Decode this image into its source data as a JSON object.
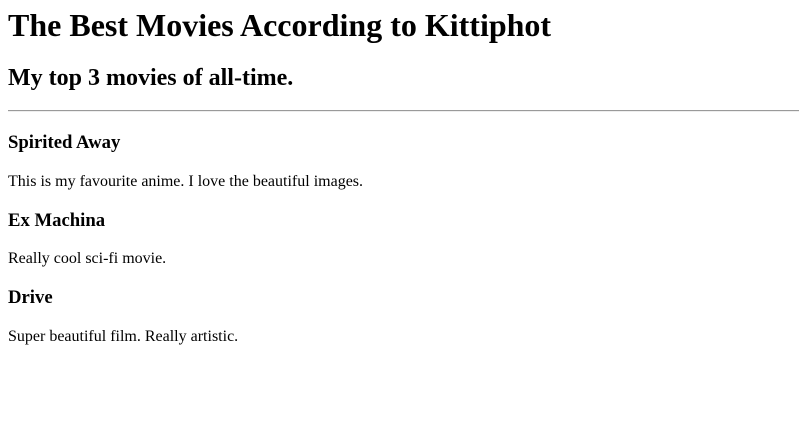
{
  "header": {
    "title": "The Best Movies According to Kittiphot",
    "subtitle": "My top 3 movies of all-time."
  },
  "movies": [
    {
      "title": "Spirited Away",
      "description": "This is my favourite anime. I love the beautiful images."
    },
    {
      "title": "Ex Machina",
      "description": "Really cool sci-fi movie."
    },
    {
      "title": "Drive",
      "description": "Super beautiful film. Really artistic."
    }
  ]
}
